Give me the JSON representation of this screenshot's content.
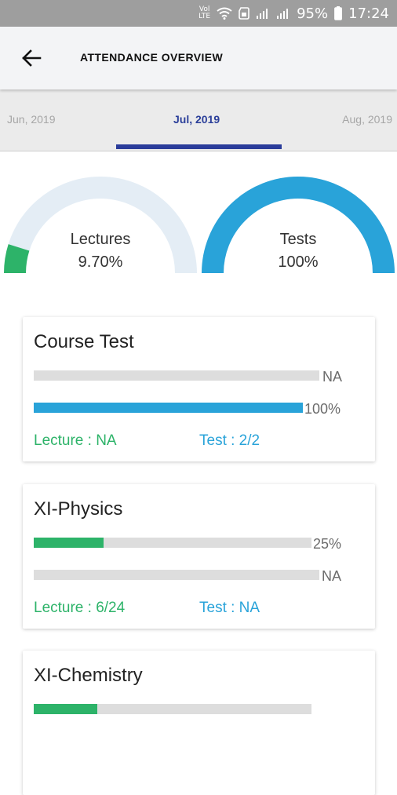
{
  "status_bar": {
    "network": "VoLTE",
    "battery": "95%",
    "time": "17:24"
  },
  "header": {
    "title": "ATTENDANCE OVERVIEW",
    "back_icon": "arrow-left-icon"
  },
  "months": {
    "previous": "Jun, 2019",
    "current": "Jul, 2019",
    "next": "Aug, 2019"
  },
  "summary": {
    "lectures": {
      "label": "Lectures",
      "value": "9.70%",
      "fraction": 0.097
    },
    "tests": {
      "label": "Tests",
      "value": "100%",
      "fraction": 1.0
    }
  },
  "courses": [
    {
      "name": "Course Test",
      "lecture_pct": "NA",
      "lecture_fraction": 0,
      "test_pct": "100%",
      "test_fraction": 1.0,
      "lecture_text": "Lecture : NA",
      "test_text": "Test : 2/2"
    },
    {
      "name": "XI-Physics",
      "lecture_pct": "25%",
      "lecture_fraction": 0.25,
      "test_pct": "NA",
      "test_fraction": 0,
      "lecture_text": "Lecture : 6/24",
      "test_text": "Test : NA"
    },
    {
      "name": "XI-Chemistry",
      "lecture_fraction": 0.23
    }
  ],
  "colors": {
    "lecture": "#2db369",
    "test": "#29a3d9",
    "track": "#dddddd",
    "gauge_track": "#e4edf5",
    "accent": "#2a3c9a"
  }
}
